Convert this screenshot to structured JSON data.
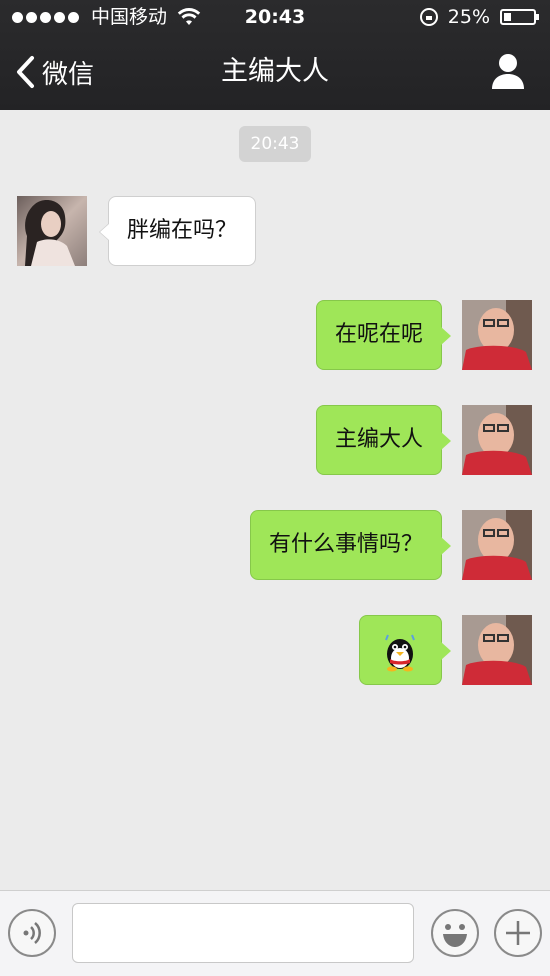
{
  "status_bar": {
    "carrier": "中国移动",
    "time": "20:43",
    "battery_percent_text": "25%",
    "battery_level": 0.25
  },
  "nav": {
    "back_label": "微信",
    "title": "主编大人"
  },
  "chat": {
    "timestamp": "20:43",
    "messages": [
      {
        "direction": "in",
        "text": "胖编在吗？"
      },
      {
        "direction": "out",
        "text": "在呢在呢"
      },
      {
        "direction": "out",
        "text": "主编大人"
      },
      {
        "direction": "out",
        "text": "有什么事情吗？"
      },
      {
        "direction": "out",
        "emoji": "qq-penguin-icon"
      }
    ]
  },
  "colors": {
    "outgoing_bubble": "#9fe658",
    "incoming_bubble": "#ffffff",
    "nav_background": "#2b2b2d"
  }
}
